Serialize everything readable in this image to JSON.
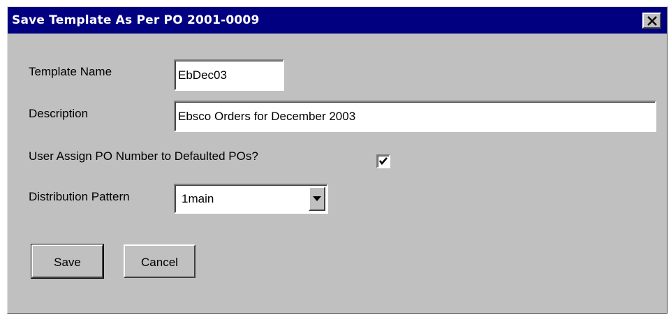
{
  "dialog": {
    "title": "Save Template As Per PO 2001-0009",
    "close_icon": "close-icon"
  },
  "form": {
    "template_name_label": "Template Name",
    "template_name_value": "EbDec03",
    "description_label": "Description",
    "description_value": "Ebsco Orders for December 2003",
    "user_assign_label": "User Assign PO Number to Defaulted POs?",
    "user_assign_checked": true,
    "distribution_label": "Distribution Pattern",
    "distribution_value": "1main"
  },
  "buttons": {
    "save_label": "Save",
    "cancel_label": "Cancel"
  },
  "colors": {
    "titlebar": "#000080",
    "dialog_bg": "#c0c0c0"
  }
}
